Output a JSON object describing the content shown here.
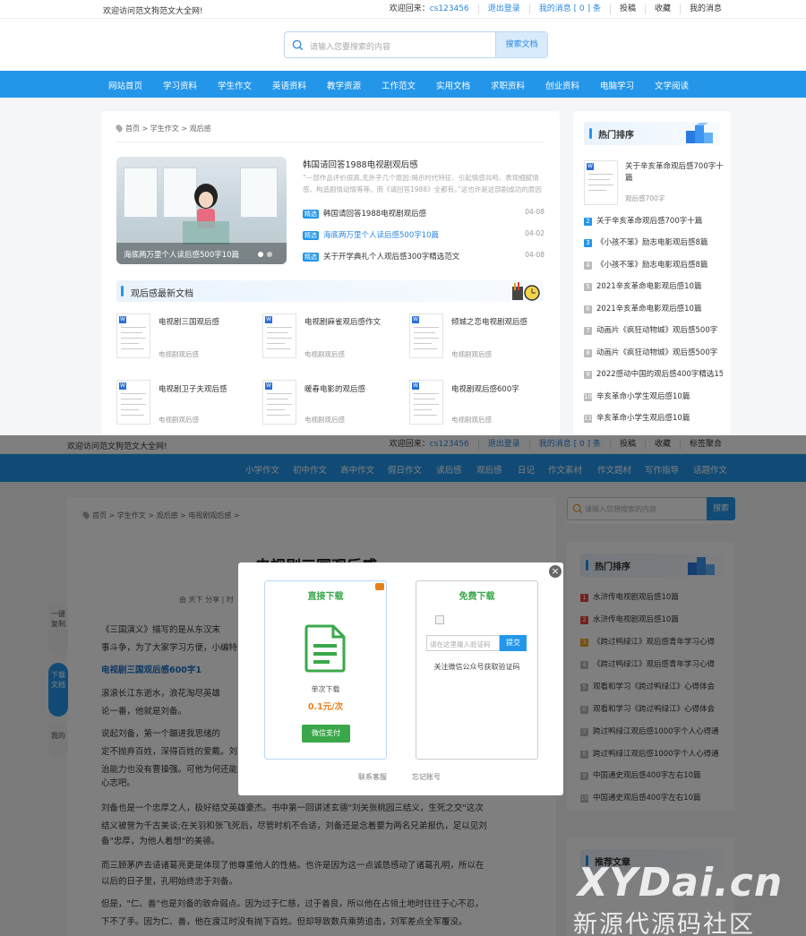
{
  "top": {
    "welcome": "欢迎访问范文狗范文大全网!",
    "right": [
      "欢迎回来：",
      "cs123456",
      "退出登录",
      "我的消息 [ 0 ] 条",
      "投稿",
      "收藏",
      "我的消息"
    ]
  },
  "search": {
    "placeholder": "请输入您要搜索的内容",
    "button": "搜索文档"
  },
  "nav": [
    "网站首页",
    "学习资料",
    "学生作文",
    "英语资料",
    "教学资源",
    "工作范文",
    "实用文档",
    "求职资料",
    "创业资料",
    "电脑学习",
    "文学阅读"
  ],
  "breadcrumb": [
    "首页",
    "学生作文",
    "观后感"
  ],
  "hero": {
    "caption": "海底两万里个人读后感500字10篇"
  },
  "feature": {
    "title": "韩国请回答1988电视剧观后感",
    "desc": "“一部作品评价很高,无外乎几个原因:揭示时代特征、引起情感共鸣、表现细腻情感、构造剧情动情等等。而《请回答1988》全都有。”这也许是这部剧成功的原因吧。小..."
  },
  "list": [
    {
      "tag": "精选",
      "title": "韩国请回答1988电视剧观后感",
      "date": "04-08"
    },
    {
      "tag": "精选",
      "title": "海底两万里个人读后感500字10篇",
      "date": "04-02"
    },
    {
      "tag": "精选",
      "title": "关于开学典礼个人观后感300字精选范文",
      "date": "04-08"
    }
  ],
  "section": {
    "title": "观后感最新文档"
  },
  "docs": [
    {
      "title": "电视剧三国观后感",
      "sub": "电视剧观后感"
    },
    {
      "title": "电视剧麻雀观后感作文",
      "sub": "电视剧观后感"
    },
    {
      "title": "倾城之恋电视剧观后感",
      "sub": "电视剧观后感"
    },
    {
      "title": "电视剧卫子夫观后感",
      "sub": "电视剧观后感"
    },
    {
      "title": "暖春电影的观后感",
      "sub": "电视剧观后感"
    },
    {
      "title": "电视剧观后感600字",
      "sub": "电视剧观后感"
    }
  ],
  "hot": {
    "title": "热门排序",
    "top": {
      "title": "关于辛亥革命观后感700字十篇",
      "sub": "观后感700字"
    },
    "items": [
      "关于辛亥革命观后感700字十篇",
      "《小孩不笨》励志电影观后感8篇",
      "《小孩不笨》励志电影观后感8篇",
      "2021辛亥革命电影观后感10篇",
      "2021辛亥革命电影观后感10篇",
      "动画片《疯狂动物城》观后感500字",
      "动画片《疯狂动物城》观后感500字",
      "2022感动中国的观后感400字精选15",
      "辛亥革命小学生观后感10篇",
      "辛亥革命小学生观后感10篇"
    ],
    "nums": [
      "2",
      "3",
      "4",
      "5",
      "6",
      "7",
      "8",
      "9",
      "10",
      "11"
    ]
  },
  "top2": {
    "welcome": "欢迎访问范文狗范文大全网!",
    "right": [
      "欢迎回来：",
      "cs123456",
      "退出登录",
      "我的消息 [ 0 ] 条",
      "投稿",
      "收藏",
      "标签聚合"
    ]
  },
  "nav2": [
    "小学作文",
    "初中作文",
    "高中作文",
    "假日作文",
    "读后感",
    "观后感",
    "日记",
    "作文素材",
    "作文题材",
    "写作指导",
    "话题作文"
  ],
  "breadcrumb2": [
    "首页",
    "学生作文",
    "观后感",
    "电视剧观后感"
  ],
  "article": {
    "title": "电视剧三国观后感",
    "meta": "由 天下 分享  |  时",
    "paras": [
      "《三国演义》描写的是从东汉末",
      "事斗争，为了大家学习方便，小编特",
      "电视剧三国观后感600字1",
      "滚滚长江东逝水，浪花淘尽英雄",
      "论一番，他就是刘备。",
      "说起刘备，第一个蹦进我思绪的",
      "定不抛弃百姓，深得百姓的爱戴。刘",
      "治能力也没有曹操强。可他为何还能",
      "心志吧。",
      "刘备也是一个忠厚之人，极好结交英雄豪杰。书中第一回讲述玄德\"刘关张桃园三结义，生死之交\"这次",
      "结义被誉为千古美谈;在关羽和张飞死后，尽管时机不合适，刘备还是念着要为两名兄弟报仇，足以见刘",
      "备\"忠厚，为他人着想\"的美德。",
      "而三顾茅庐去请诸葛亮更是体现了他尊重他人的性格。也许是因为这一点诚恳感动了诸葛孔明，所以在",
      "以后的日子里，孔明始终忠于刘备。",
      "但是，\"仁、善\"也是刘备的致命弱点。因为过于仁慈，过于善良，所以他在占领土地时往往于心不忍，",
      "下不了手。因为仁、善，他在渡江时没有抛下百姓。但却导致数兵乘势追击，刘军差点全军覆没。"
    ]
  },
  "float": [
    {
      "label": "一键复制"
    },
    {
      "label": "下载文档"
    },
    {
      "label": "我的"
    }
  ],
  "search2": {
    "placeholder": "请输入您想搜索的内容",
    "button": "搜索"
  },
  "hot2": {
    "title": "热门排序",
    "items": [
      "水浒传电视剧观后感10篇",
      "水浒传电视剧观后感10篇",
      "《跨过鸭绿江》观后感青年学习心得",
      "《跨过鸭绿江》观后感青年学习心得",
      "观看和学习《跨过鸭绿江》心得体会",
      "观看和学习《跨过鸭绿江》心得体会",
      "跨过鸭绿江观后感1000字个人心得通",
      "跨过鸭绿江观后感1000字个人心得通",
      "中国通史观后感400字左右10篇",
      "中国通史观后感400字左右10篇"
    ],
    "nums": [
      "1",
      "2",
      "3",
      "4",
      "5",
      "6",
      "7",
      "8",
      "9",
      "10"
    ]
  },
  "recommend": {
    "title": "推荐文章"
  },
  "modal": {
    "paid": {
      "title": "直接下载",
      "single": "单次下载",
      "price": "0.1元/次",
      "pay": "微信支付"
    },
    "free": {
      "title": "免费下载",
      "placeholder": "请在这里输入验证码",
      "submit": "提交",
      "note": "关注微信公众号获取验证码"
    },
    "links": [
      "联系客服",
      "忘记账号"
    ]
  },
  "watermark": {
    "line1": "XYDai.cn",
    "line2": "新源代源码社区"
  },
  "colors": {
    "primary": "#2396ea",
    "green": "#3aa84a",
    "orange": "#e8801a"
  }
}
